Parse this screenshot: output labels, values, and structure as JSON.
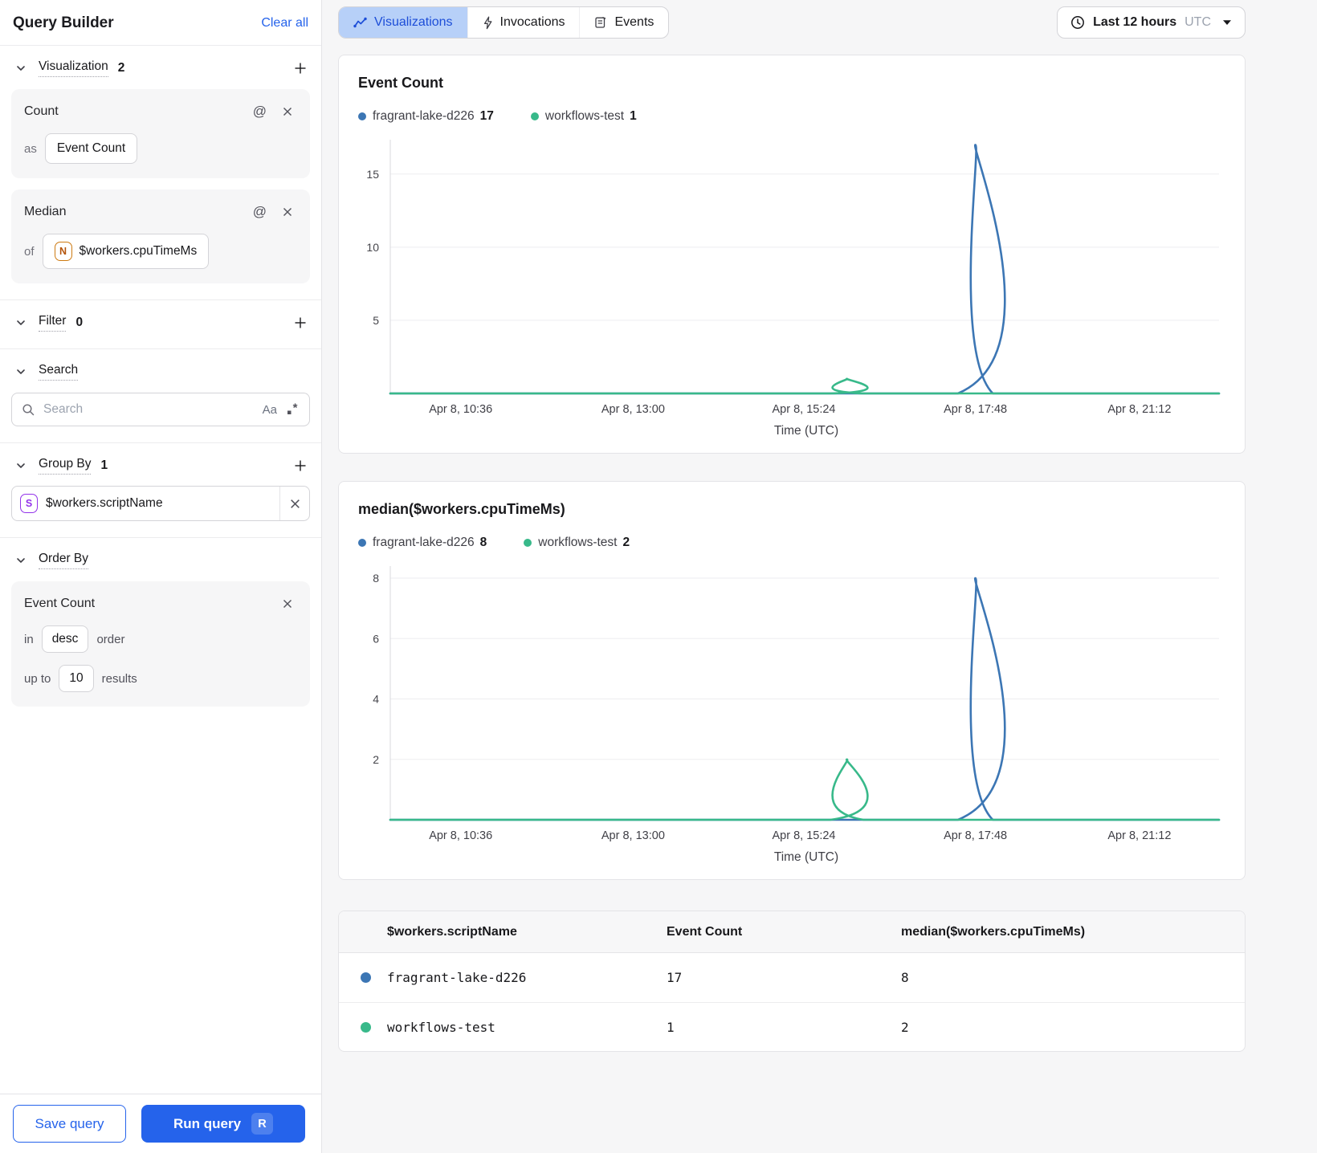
{
  "colors": {
    "accent_blue": "#2563eb",
    "active_tab_bg": "#b7d0f8",
    "active_tab_text": "#1d4ed8",
    "series_blue": "#3c76b4",
    "series_green": "#38b98a",
    "badge_number_orange": "#b45309",
    "badge_string_purple": "#9333ea"
  },
  "icons": {
    "chevron-down-icon": "v-chevron shape",
    "plus-icon": "+",
    "at-icon": "@",
    "close-icon": "x",
    "search-icon": "magnifier",
    "match-case-icon": "Aa",
    "regex-icon": ".*",
    "visualizations-icon": "line-chart",
    "invocations-icon": "lightning-bolt",
    "events-icon": "note",
    "clock-icon": "clock",
    "caret-down-icon": "filled triangle"
  },
  "sidebar": {
    "title": "Query Builder",
    "clear_all_label": "Clear all",
    "at_glyph": "@",
    "sections": {
      "visualization": {
        "label": "Visualization",
        "count": "2"
      },
      "filter": {
        "label": "Filter",
        "count": "0"
      },
      "search": {
        "label": "Search"
      },
      "group_by": {
        "label": "Group By",
        "count": "1"
      },
      "order_by": {
        "label": "Order By"
      }
    },
    "visualization_cards": [
      {
        "title": "Count",
        "prefix": "as",
        "value": "Event Count"
      },
      {
        "title": "Median",
        "prefix": "of",
        "badge_letter": "N",
        "value": "$workers.cpuTimeMs"
      }
    ],
    "search_input": {
      "placeholder": "Search",
      "match_case_label": "Aa"
    },
    "group_by_items": [
      {
        "badge_letter": "S",
        "value": "$workers.scriptName"
      }
    ],
    "order_by_card": {
      "title": "Event Count",
      "in_label": "in",
      "direction": "desc",
      "order_label": "order",
      "upto_label": "up to",
      "limit": "10",
      "results_label": "results"
    },
    "footer": {
      "save_label": "Save query",
      "run_label": "Run query",
      "run_shortcut": "R"
    }
  },
  "toolbar": {
    "tabs": [
      {
        "label": "Visualizations",
        "active": true
      },
      {
        "label": "Invocations",
        "active": false
      },
      {
        "label": "Events",
        "active": false
      }
    ],
    "time_range": {
      "label": "Last 12 hours",
      "timezone": "UTC"
    }
  },
  "chart_data": [
    {
      "type": "line",
      "title": "Event Count",
      "xlabel": "Time (UTC)",
      "grid": true,
      "legend_position": "top",
      "x_tick_labels": [
        "Apr 8, 10:36",
        "Apr 8, 13:00",
        "Apr 8, 15:24",
        "Apr 8, 17:48",
        "Apr 8, 21:12"
      ],
      "x_tick_pos": [
        0.085,
        0.293,
        0.499,
        0.706,
        0.904
      ],
      "y_ticks": [
        5,
        10,
        15
      ],
      "ylim": [
        0,
        17.35
      ],
      "series": [
        {
          "name": "fragrant-lake-d226",
          "color": "#3c76b4",
          "legend_value": "17",
          "points": [
            [
              0,
              0
            ],
            [
              0.685,
              0
            ],
            [
              0.706,
              17
            ],
            [
              0.727,
              0
            ],
            [
              1,
              0
            ]
          ]
        },
        {
          "name": "workflows-test",
          "color": "#38b98a",
          "legend_value": "1",
          "points": [
            [
              0,
              0
            ],
            [
              0.531,
              0
            ],
            [
              0.551,
              1
            ],
            [
              0.571,
              0
            ],
            [
              1,
              0
            ]
          ]
        }
      ]
    },
    {
      "type": "line",
      "title": "median($workers.cpuTimeMs)",
      "xlabel": "Time (UTC)",
      "grid": true,
      "legend_position": "top",
      "x_tick_labels": [
        "Apr 8, 10:36",
        "Apr 8, 13:00",
        "Apr 8, 15:24",
        "Apr 8, 17:48",
        "Apr 8, 21:12"
      ],
      "x_tick_pos": [
        0.085,
        0.293,
        0.499,
        0.706,
        0.904
      ],
      "y_ticks": [
        2,
        4,
        6,
        8
      ],
      "ylim": [
        0,
        8.4
      ],
      "series": [
        {
          "name": "fragrant-lake-d226",
          "color": "#3c76b4",
          "legend_value": "8",
          "points": [
            [
              0,
              0
            ],
            [
              0.685,
              0
            ],
            [
              0.706,
              8
            ],
            [
              0.727,
              0
            ],
            [
              1,
              0
            ]
          ]
        },
        {
          "name": "workflows-test",
          "color": "#38b98a",
          "legend_value": "2",
          "points": [
            [
              0,
              0
            ],
            [
              0.531,
              0
            ],
            [
              0.551,
              2
            ],
            [
              0.571,
              0
            ],
            [
              1,
              0
            ]
          ]
        }
      ]
    },
    {
      "type": "table",
      "columns": [
        "$workers.scriptName",
        "Event Count",
        "median($workers.cpuTimeMs)"
      ],
      "rows": [
        {
          "dot_color": "#3c76b4",
          "cells": [
            "fragrant-lake-d226",
            "17",
            "8"
          ]
        },
        {
          "dot_color": "#38b98a",
          "cells": [
            "workflows-test",
            "1",
            "2"
          ]
        }
      ]
    }
  ]
}
